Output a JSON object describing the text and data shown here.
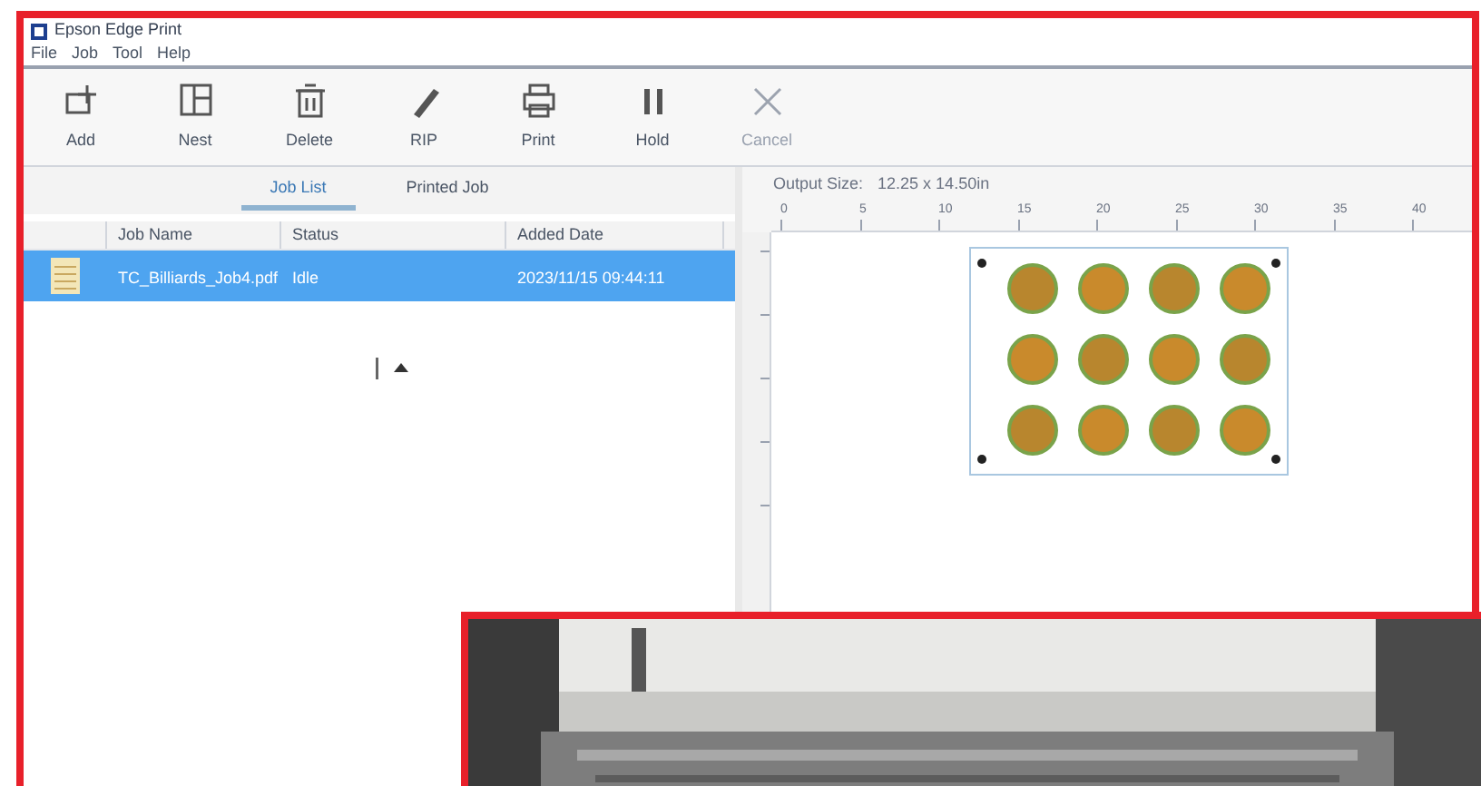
{
  "window": {
    "title": "Epson Edge Print"
  },
  "menu": [
    "File",
    "Job",
    "Tool",
    "Help"
  ],
  "toolbar": [
    {
      "label": "Add",
      "disabled": false
    },
    {
      "label": "Nest",
      "disabled": false
    },
    {
      "label": "Delete",
      "disabled": false
    },
    {
      "label": "RIP",
      "disabled": false
    },
    {
      "label": "Print",
      "disabled": false
    },
    {
      "label": "Hold",
      "disabled": false
    },
    {
      "label": "Cancel",
      "disabled": true
    }
  ],
  "tabs": [
    {
      "label": "Job List",
      "selected": true
    },
    {
      "label": "Printed Job",
      "selected": false
    }
  ],
  "table": {
    "columns": [
      "Job Name",
      "Status",
      "Added Date"
    ],
    "rows": [
      {
        "cells": [
          "TC_Billiards_Job4.pdf",
          "Idle",
          "2023/11/15 09:44:11"
        ],
        "selected": true
      }
    ]
  },
  "preview": {
    "output_size_label": "Output Size:",
    "output_size": "12.25 x 14.50in",
    "ruler_ticks": [
      "0",
      "5",
      "10",
      "15",
      "20",
      "25",
      "30",
      "35",
      "40"
    ]
  }
}
